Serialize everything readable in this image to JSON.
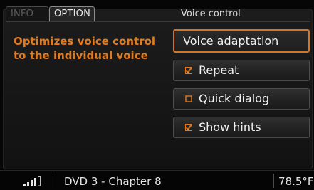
{
  "tabs": [
    {
      "label": "INFO",
      "active": false
    },
    {
      "label": "OPTION",
      "active": true
    }
  ],
  "section_title": "Voice control",
  "description": "Optimizes voice control to the individual voice",
  "options": [
    {
      "label": "Voice adaptation",
      "selected": true,
      "checkbox": false
    },
    {
      "label": "Repeat",
      "selected": false,
      "checkbox": true,
      "checked": true
    },
    {
      "label": "Quick dialog",
      "selected": false,
      "checkbox": true,
      "checked": false
    },
    {
      "label": "Show hints",
      "selected": false,
      "checkbox": true,
      "checked": true
    }
  ],
  "statusbar": {
    "signal_icon": "signal-strength-icon",
    "media": "DVD 3 - Chapter 8",
    "temperature": "78.5°F"
  },
  "colors": {
    "accent": "#e07a1e",
    "text": "#f2f2f2"
  }
}
